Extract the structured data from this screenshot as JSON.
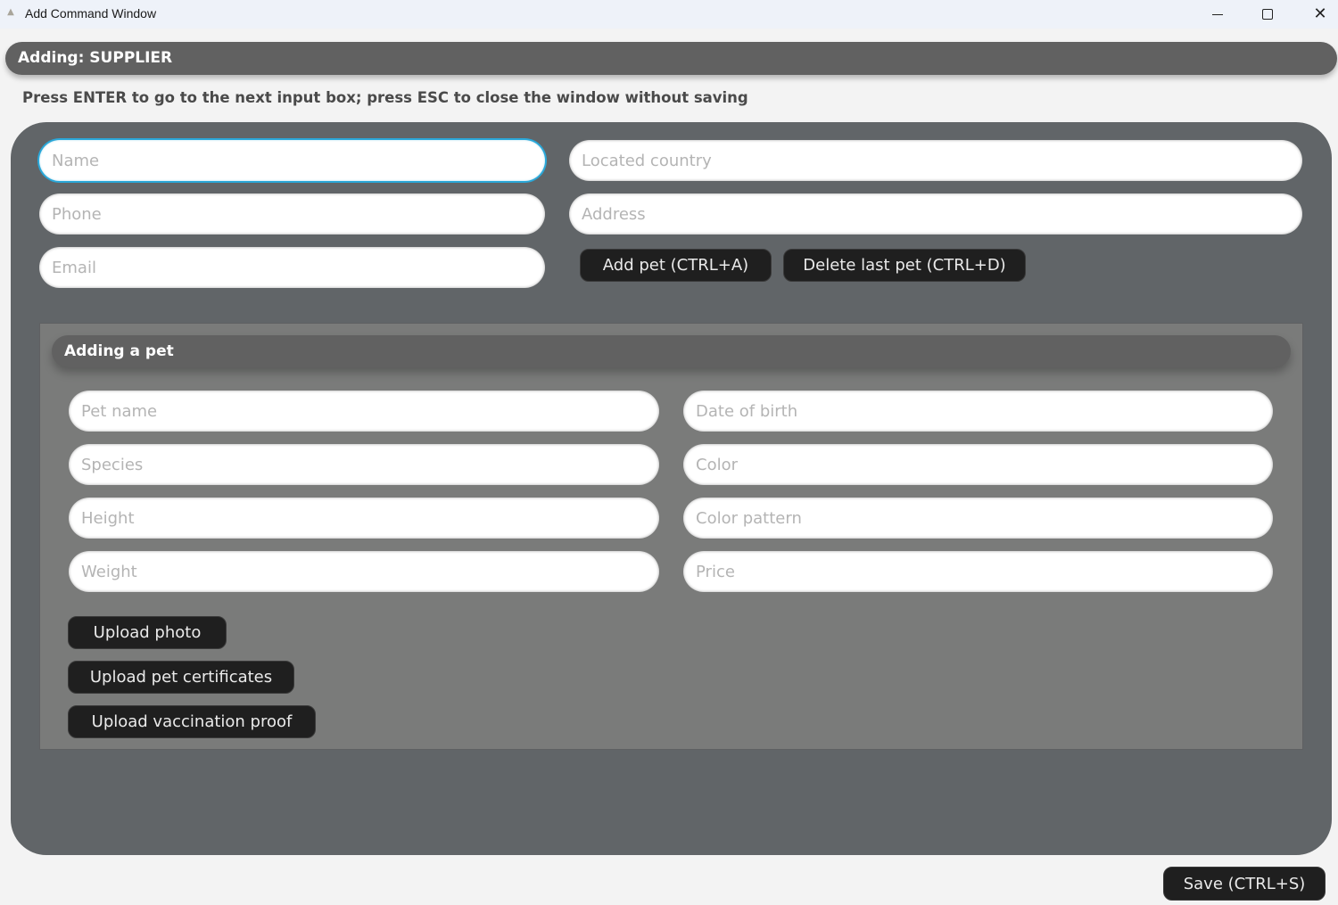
{
  "window": {
    "title": "Add Command Window",
    "app_icon": "app-logo-icon",
    "controls": {
      "minimize_icon": "minimize-icon",
      "maximize_icon": "maximize-icon",
      "close_icon": "close-icon",
      "close_glyph": "✕"
    }
  },
  "header": {
    "title": "Adding: SUPPLIER"
  },
  "hint": "Press ENTER to go to the next input box; press ESC to close the window without saving",
  "supplier_form": {
    "name": {
      "placeholder": "Name",
      "value": ""
    },
    "phone": {
      "placeholder": "Phone",
      "value": ""
    },
    "email": {
      "placeholder": "Email",
      "value": ""
    },
    "located_country": {
      "placeholder": "Located country",
      "value": ""
    },
    "address": {
      "placeholder": "Address",
      "value": ""
    },
    "add_pet_label": "Add pet (CTRL+A)",
    "delete_last_pet_label": "Delete last pet (CTRL+D)"
  },
  "pet_form": {
    "title": "Adding a pet",
    "pet_name": {
      "placeholder": "Pet name",
      "value": ""
    },
    "species": {
      "placeholder": "Species",
      "value": ""
    },
    "height": {
      "placeholder": "Height",
      "value": ""
    },
    "weight": {
      "placeholder": "Weight",
      "value": ""
    },
    "date_of_birth": {
      "placeholder": "Date of birth",
      "value": ""
    },
    "color": {
      "placeholder": "Color",
      "value": ""
    },
    "color_pattern": {
      "placeholder": "Color pattern",
      "value": ""
    },
    "price": {
      "placeholder": "Price",
      "value": ""
    },
    "upload_photo_label": "Upload photo",
    "upload_certificates_label": "Upload pet certificates",
    "upload_vaccination_label": "Upload vaccination proof"
  },
  "footer": {
    "save_label": "Save (CTRL+S)"
  },
  "colors": {
    "focus_accent": "#2aa7d8",
    "panel_bg": "#616568",
    "pet_panel_bg": "#7a7b7a",
    "button_bg": "#1f1f1f"
  }
}
